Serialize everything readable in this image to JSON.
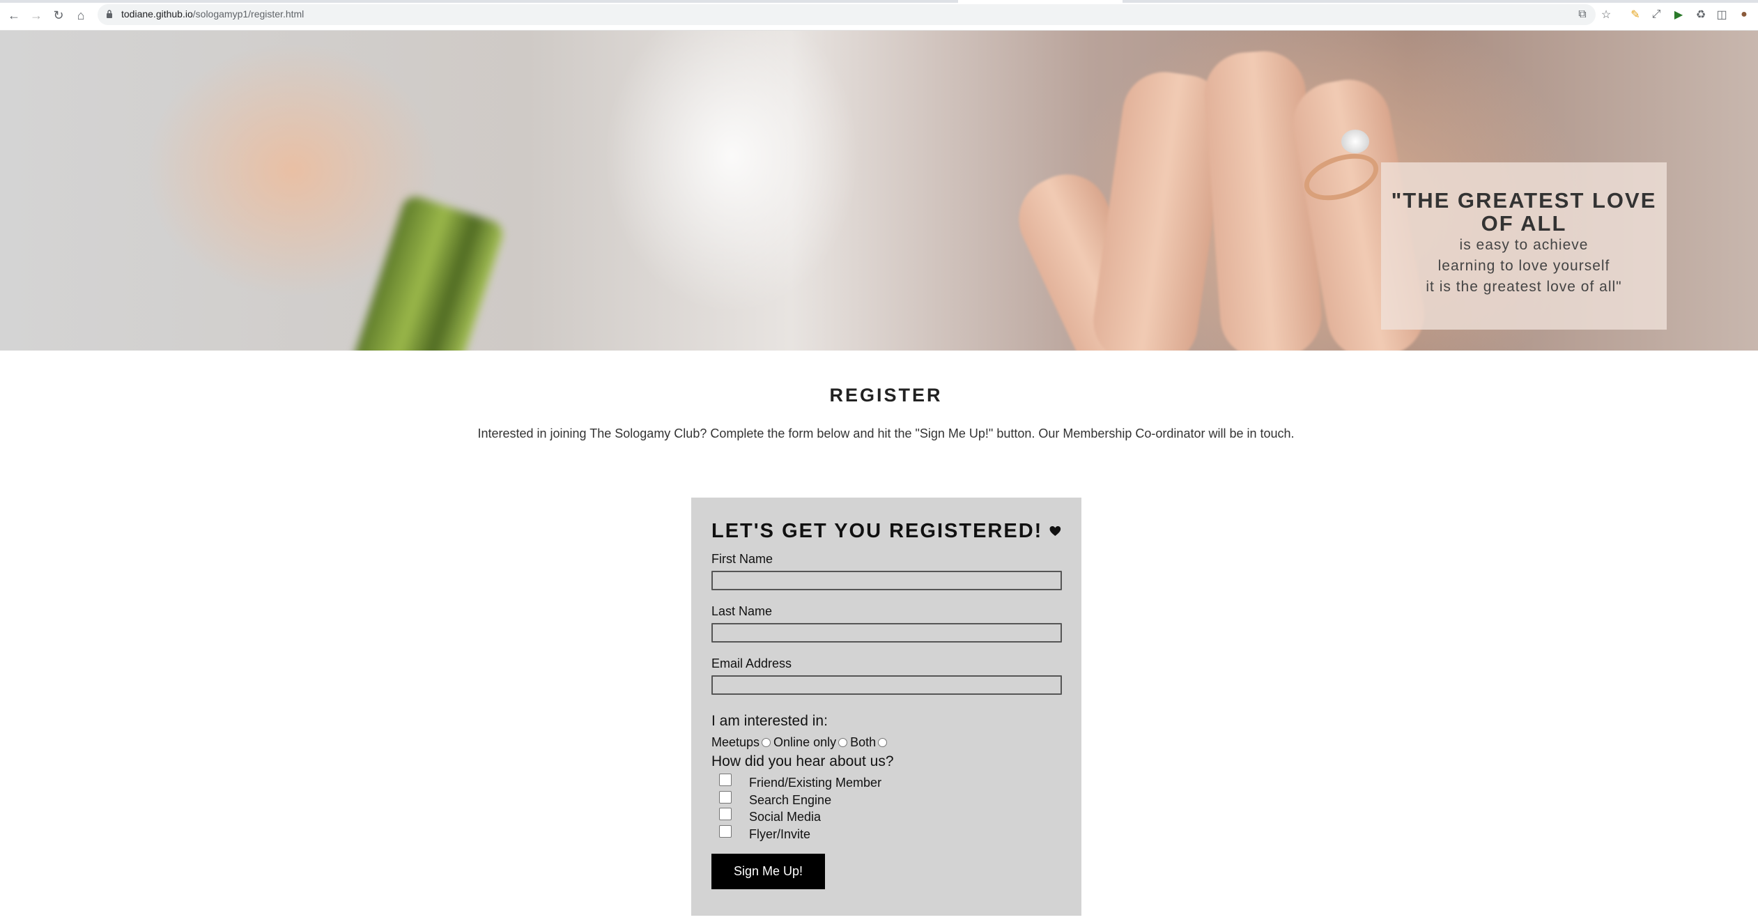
{
  "browser": {
    "url_host": "todiane.github.io",
    "url_path": "/sologamyp1/register.html"
  },
  "hero": {
    "quote_title": "\"THE GREATEST LOVE OF ALL",
    "quote_lines": [
      "is easy to achieve",
      "learning to love yourself",
      "it is the greatest love of all\""
    ]
  },
  "main": {
    "title": "REGISTER",
    "intro": "Interested in joining The Sologamy Club? Complete the form below and hit the \"Sign Me Up!\" button. Our Membership Co-ordinator will be in touch."
  },
  "form": {
    "heading": "LET'S GET YOU REGISTERED!",
    "heading_icon": "heart-icon",
    "first_name_label": "First Name",
    "first_name_value": "",
    "last_name_label": "Last Name",
    "last_name_value": "",
    "email_label": "Email Address",
    "email_value": "",
    "interest_label": "I am interested in:",
    "interest_options": [
      "Meetups",
      "Online only",
      "Both"
    ],
    "hear_label": "How did you hear about us?",
    "hear_options": [
      "Friend/Existing Member",
      "Search Engine",
      "Social Media",
      "Flyer/Invite"
    ],
    "submit_label": "Sign Me Up!"
  },
  "colors": {
    "form_background": "#d3d3d3",
    "button_background": "#000000",
    "quote_box": "#f0e1da"
  }
}
